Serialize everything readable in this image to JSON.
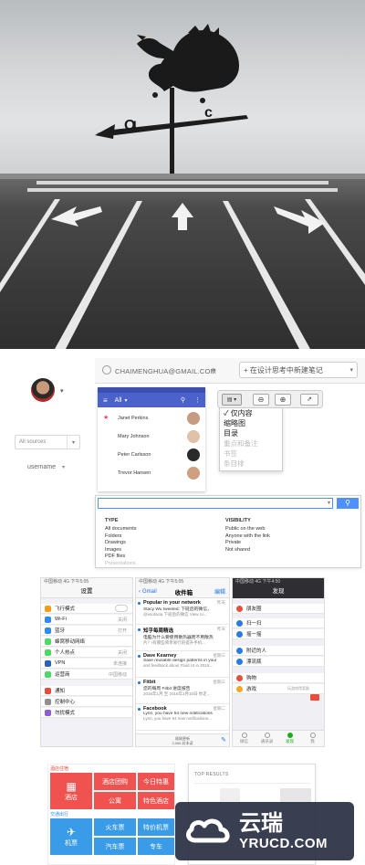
{
  "account": {
    "email": "CHAIMENGHUA@GMAIL.COM",
    "email_arrow": "▾",
    "new_note": "+ 在设计思考中新建笔记",
    "note_arrow": "▾"
  },
  "sidebar": {
    "sources": "All sources",
    "username": "username"
  },
  "android": {
    "title": "All",
    "contacts": [
      "Janet Perkins",
      "Mary Johnson",
      "Peter Carlsson",
      "Trevor Hansen"
    ]
  },
  "view_menu": {
    "items": [
      "✓ 仅内容",
      "缩略图",
      "目录",
      "重点和备注",
      "书签",
      "条目排"
    ]
  },
  "search": {
    "type_header": "TYPE",
    "types": [
      "All documents",
      "Folders",
      "Drawings",
      "Images",
      "PDF files",
      "Presentations"
    ],
    "visibility_header": "VISIBILITY",
    "visibility": [
      "Public on the web",
      "Anyone with the link",
      "Private",
      "Not shared"
    ]
  },
  "ios_settings": {
    "status": "中国移动 4G    下午5:05",
    "title": "设置",
    "rows": [
      {
        "label": "飞行模式",
        "value": "",
        "color": "#f39c12"
      },
      {
        "label": "Wi-Fi",
        "value": "关闭",
        "color": "#2d8cf0"
      },
      {
        "label": "蓝牙",
        "value": "打开",
        "color": "#2d8cf0"
      },
      {
        "label": "蜂窝移动网络",
        "value": "",
        "color": "#4cd964"
      },
      {
        "label": "个人热点",
        "value": "关闭",
        "color": "#4cd964"
      },
      {
        "label": "VPN",
        "value": "未连接",
        "color": "#2d5fbf"
      },
      {
        "label": "运营商",
        "value": "中国移动",
        "color": "#4cd964"
      },
      {
        "label": "通知",
        "value": "",
        "color": "#e74c3c"
      },
      {
        "label": "控制中心",
        "value": "",
        "color": "#8e8e93"
      },
      {
        "label": "勿扰模式",
        "value": "",
        "color": "#8e5cd6"
      }
    ]
  },
  "ios_mail": {
    "status": "中国移动 4G   下午5:05",
    "back": "Gmail",
    "title": "收件箱",
    "edit": "编辑",
    "mails": [
      {
        "from": "Popular in your network",
        "when": "昨天",
        "line1": "Stacy Wu tweeted: 下班后的微信，",
        "line2": "@esofacia 下班后的微信 View co..."
      },
      {
        "from": "知乎每周精选",
        "when": "昨天",
        "line1": "电脑为什么要使用散热器而不用散热",
        "line2": "片？/有哪些简单易行的提升手机..."
      },
      {
        "from": "Dave Kearney",
        "when": "星期三",
        "line1": "Save reusable design patterns in your",
        "line2": "and feedback about Fluid UI in 2015..."
      },
      {
        "from": "Fitbit",
        "when": "星期三",
        "line1": "您的每周 Fitbit 进度报告",
        "line2": "2016年1月 至 2016年1月10日 你走..."
      },
      {
        "from": "Facebook",
        "when": "星期二",
        "line1": "Lynn, you have 54 new notifications",
        "line2": "Lynn, you have 54 new notifications..."
      }
    ],
    "footer": "刚刚更新\n2,066 封未读"
  },
  "wechat": {
    "status": "中国移动 4G   下午4:50",
    "title": "发现",
    "rows": [
      "朋友圈",
      "扫一扫",
      "摇一摇",
      "附近的人",
      "漂流瓶",
      "购物",
      "游戏"
    ],
    "game_hint": "玩游戏得奖励",
    "tabs": [
      "微信",
      "通讯录",
      "发现",
      "我"
    ]
  },
  "travel": {
    "hotel_header": "酒店住宿",
    "hotel": "酒店",
    "hotel_deals": "酒店团购",
    "today_special": "今日特惠",
    "apartment": "公寓",
    "special_hotel": "特色酒店",
    "transport_header": "交通出行",
    "flight": "机票",
    "train": "火车票",
    "special_flight": "特价机票",
    "bus": "汽车票",
    "car": "专车"
  },
  "top_results": {
    "header": "TOP RESULTS"
  },
  "watermark": {
    "brand": "云瑞",
    "domain": "YRUCD.COM"
  }
}
